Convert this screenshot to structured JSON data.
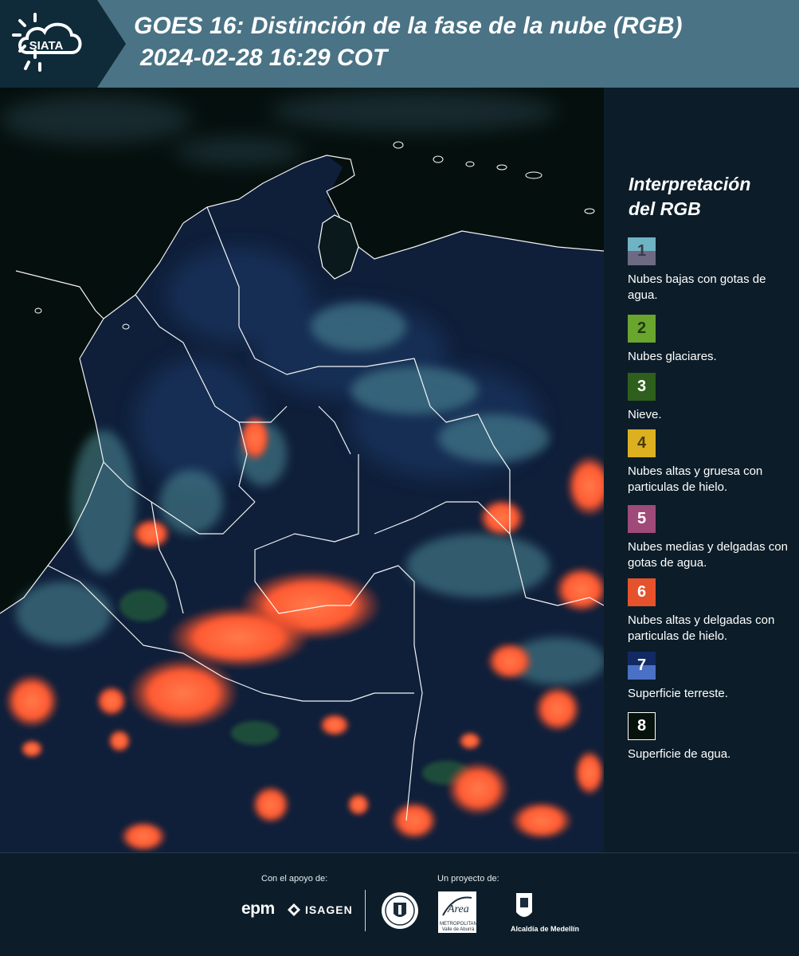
{
  "header": {
    "logo_text": "SIATA",
    "title_line1": "GOES 16: Distinción de la fase de la nube (RGB)",
    "title_line2": "2024-02-28 16:29 COT",
    "background_color": "#4a7385"
  },
  "legend": {
    "title_line1": "Interpretación",
    "title_line2": "del RGB",
    "items": [
      {
        "number": "1",
        "label": "Nubes bajas con gotas de agua.",
        "colors": [
          "#6fb4c4",
          "#6e6a83"
        ]
      },
      {
        "number": "2",
        "label": "Nubes glaciares.",
        "colors": [
          "#6aa52e"
        ]
      },
      {
        "number": "3",
        "label": "Nieve.",
        "colors": [
          "#2f5f1c"
        ]
      },
      {
        "number": "4",
        "label": "Nubes altas y gruesa con particulas de hielo.",
        "colors": [
          "#dcb01f"
        ]
      },
      {
        "number": "5",
        "label": "Nubes medias y delgadas con gotas de agua.",
        "colors": [
          "#a04a7a"
        ]
      },
      {
        "number": "6",
        "label": "Nubes altas y delgadas con particulas de hielo.",
        "colors": [
          "#e5522c"
        ]
      },
      {
        "number": "7",
        "label": "Superficie terreste.",
        "colors": [
          "#122a63",
          "#4a71c5"
        ]
      },
      {
        "number": "8",
        "label": "Superficie de agua.",
        "colors": [
          "#06120c"
        ]
      }
    ]
  },
  "footer": {
    "support_label": "Con el apoyo de:",
    "project_label": "Un proyecto de:",
    "epm_text": "epm",
    "isagen_text": "ISAGEN",
    "area_text": "Área",
    "area_subtext": "METROPOLITANA Valle de Aburrá",
    "alcaldia_text": "Alcaldía de Medellín"
  },
  "map": {
    "description_colors": {
      "water": "#05100e",
      "land": "#0f1f3a",
      "ice_cloud": "#ff5a32",
      "low_cloud": "#5a8fa0",
      "border": "#ffffff"
    }
  }
}
